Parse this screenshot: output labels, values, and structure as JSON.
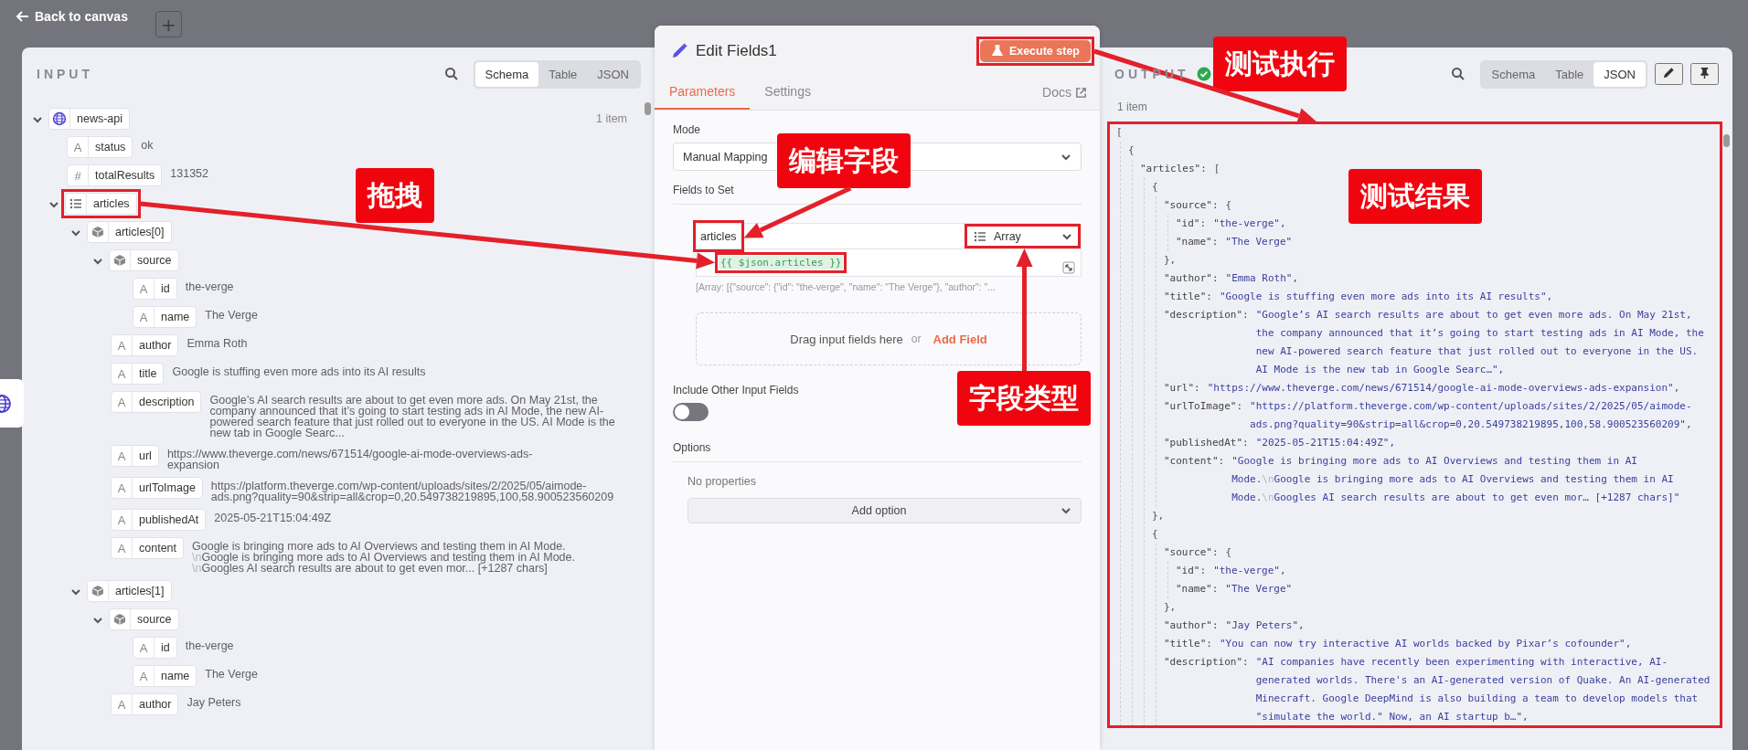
{
  "topbar": {
    "back_label": "Back to canvas",
    "add_label": "+"
  },
  "input": {
    "title": "INPUT",
    "views": [
      {
        "label": "Schema",
        "selected": true
      },
      {
        "label": "Table",
        "selected": false
      },
      {
        "label": "JSON",
        "selected": false
      }
    ],
    "tree": [
      {
        "kind": "node",
        "key": "news-api",
        "count": "1 item",
        "expanded": true,
        "children": [
          {
            "kind": "string",
            "glyph": "A",
            "key": "status",
            "value": "ok"
          },
          {
            "kind": "number",
            "glyph": "#",
            "key": "totalResults",
            "value": "131352"
          },
          {
            "kind": "array",
            "key": "articles",
            "expanded": true,
            "highlighted": true,
            "children": [
              {
                "kind": "object",
                "key": "articles[0]",
                "expanded": true,
                "children": [
                  {
                    "kind": "object",
                    "key": "source",
                    "expanded": true,
                    "children": [
                      {
                        "kind": "string",
                        "glyph": "A",
                        "key": "id",
                        "value": "the-verge"
                      },
                      {
                        "kind": "string",
                        "glyph": "A",
                        "key": "name",
                        "value": "The Verge"
                      }
                    ]
                  },
                  {
                    "kind": "string",
                    "glyph": "A",
                    "key": "author",
                    "value": "Emma Roth"
                  },
                  {
                    "kind": "string",
                    "glyph": "A",
                    "key": "title",
                    "value": "Google is stuffing even more ads into its AI results"
                  },
                  {
                    "kind": "string",
                    "glyph": "A",
                    "key": "description",
                    "value": "Google’s AI search results are about to get even more ads. On May 21st, the company announced that it’s going to start testing ads in AI Mode, the new AI-powered search feature that just rolled out to everyone in the US. AI Mode is the new tab in Google Searc..."
                  },
                  {
                    "kind": "string",
                    "glyph": "A",
                    "key": "url",
                    "value": "https://www.theverge.com/news/671514/google-ai-mode-overviews-ads-expansion"
                  },
                  {
                    "kind": "string",
                    "glyph": "A",
                    "key": "urlToImage",
                    "value": "https://platform.theverge.com/wp-content/uploads/sites/2/2025/05/aimode-ads.png?quality=90&strip=all&crop=0,20.549738219895,100,58.900523560209"
                  },
                  {
                    "kind": "string",
                    "glyph": "A",
                    "key": "publishedAt",
                    "value": "2025-05-21T15:04:49Z"
                  },
                  {
                    "kind": "string",
                    "glyph": "A",
                    "key": "content",
                    "segments": [
                      {
                        "kind": "text",
                        "text": "Google is bringing more ads to AI Overviews and testing them in AI Mode."
                      },
                      {
                        "kind": "escape",
                        "text": "\\n"
                      },
                      {
                        "kind": "text",
                        "text": "Google is bringing more ads to AI Overviews and testing them in AI Mode."
                      },
                      {
                        "kind": "escape",
                        "text": "\\n"
                      },
                      {
                        "kind": "text",
                        "text": "Googles AI search results are about to get even mor... [+1287 chars]"
                      }
                    ]
                  }
                ]
              },
              {
                "kind": "object",
                "key": "articles[1]",
                "expanded": true,
                "children": [
                  {
                    "kind": "object",
                    "key": "source",
                    "expanded": true,
                    "children": [
                      {
                        "kind": "string",
                        "glyph": "A",
                        "key": "id",
                        "value": "the-verge"
                      },
                      {
                        "kind": "string",
                        "glyph": "A",
                        "key": "name",
                        "value": "The Verge"
                      }
                    ]
                  },
                  {
                    "kind": "string",
                    "glyph": "A",
                    "key": "author",
                    "value": "Jay Peters"
                  }
                ]
              }
            ]
          }
        ]
      }
    ]
  },
  "node": {
    "title": "Edit Fields1",
    "execute_label": "Execute step",
    "tabs": [
      {
        "label": "Parameters",
        "selected": true
      },
      {
        "label": "Settings",
        "selected": false
      }
    ],
    "docs_label": "Docs",
    "mode": {
      "label": "Mode",
      "value": "Manual Mapping"
    },
    "fields_label": "Fields to Set",
    "field": {
      "name": "articles",
      "type": "Array",
      "expression": "{{ $json.articles }}",
      "preview": "[Array: [{\"source\": {\"id\": \"the-verge\", \"name\": \"The Verge\"}, \"author\": \"...",
      "highlighted": true
    },
    "drop": {
      "hint": "Drag input fields here",
      "or": "or",
      "add": "Add Field"
    },
    "include": {
      "label": "Include Other Input Fields",
      "on": false
    },
    "options": {
      "label": "Options",
      "empty": "No properties",
      "add": "Add option"
    }
  },
  "output": {
    "title": "OUTPUT",
    "success": true,
    "views": [
      {
        "label": "Schema",
        "selected": false
      },
      {
        "label": "Table",
        "selected": false
      },
      {
        "label": "JSON",
        "selected": true
      }
    ],
    "count": "1 item",
    "json": {
      "open": "[",
      "children": [
        {
          "open": "{",
          "children": [
            {
              "key": "\"articles\":",
              "open": "[",
              "children": [
                {
                  "open": "{",
                  "close": "},",
                  "children": [
                    {
                      "key": "\"source\":",
                      "open": "{",
                      "close": "},",
                      "children": [
                        {
                          "key": "\"id\":",
                          "value": "\"the-verge\","
                        },
                        {
                          "key": "\"name\":",
                          "value": "\"The Verge\""
                        }
                      ]
                    },
                    {
                      "key": "\"author\":",
                      "value": "\"Emma Roth\","
                    },
                    {
                      "key": "\"title\":",
                      "value": "\"Google is stuffing even more ads into its AI results\","
                    },
                    {
                      "key": "\"description\":",
                      "value": "\"Google’s AI search results are about to get even more ads. On May 21st, the company announced that it’s going to start testing ads in AI Mode, the new AI-powered search feature that just rolled out to everyone in the US. AI Mode is the new tab in Google Searc…\","
                    },
                    {
                      "key": "\"url\":",
                      "value": "\"https://www.theverge.com/news/671514/google-ai-mode-overviews-ads-expansion\","
                    },
                    {
                      "key": "\"urlToImage\":",
                      "value": "\"https://platform.theverge.com/wp-content/uploads/sites/2/2025/05/aimode-ads.png?quality=90&strip=all&crop=0,20.549738219895,100,58.900523560209\","
                    },
                    {
                      "key": "\"publishedAt\":",
                      "value": "\"2025-05-21T15:04:49Z\","
                    },
                    {
                      "key": "\"content\":",
                      "segments": [
                        {
                          "kind": "text",
                          "text": "\"Google is bringing more ads to AI Overviews and testing them in AI Mode."
                        },
                        {
                          "kind": "escape",
                          "text": "\\n"
                        },
                        {
                          "kind": "text",
                          "text": "Google is bringing more ads to AI Overviews and testing them in AI Mode."
                        },
                        {
                          "kind": "escape",
                          "text": "\\n"
                        },
                        {
                          "kind": "text",
                          "text": "Googles AI search results are about to get even mor… [+1287 chars]\""
                        }
                      ]
                    }
                  ]
                },
                {
                  "open": "{",
                  "children": [
                    {
                      "key": "\"source\":",
                      "open": "{",
                      "close": "},",
                      "children": [
                        {
                          "key": "\"id\":",
                          "value": "\"the-verge\","
                        },
                        {
                          "key": "\"name\":",
                          "value": "\"The Verge\""
                        }
                      ]
                    },
                    {
                      "key": "\"author\":",
                      "value": "\"Jay Peters\","
                    },
                    {
                      "key": "\"title\":",
                      "value": "\"You can now try interactive AI worlds backed by Pixar’s cofounder\","
                    },
                    {
                      "key": "\"description\":",
                      "value": "\"AI companies have recently been experimenting with interactive, AI-generated worlds. There's an AI-generated version of Quake. An AI-generated Minecraft. Google DeepMind is also building a team to develop models that \"simulate the world.\" Now, an AI startup b…\","
                    }
                  ]
                }
              ]
            }
          ]
        }
      ]
    }
  },
  "callouts": [
    {
      "text": "拖拽"
    },
    {
      "text": "编辑字段"
    },
    {
      "text": "字段类型"
    },
    {
      "text": "测试执行"
    },
    {
      "text": "测试结果"
    }
  ]
}
